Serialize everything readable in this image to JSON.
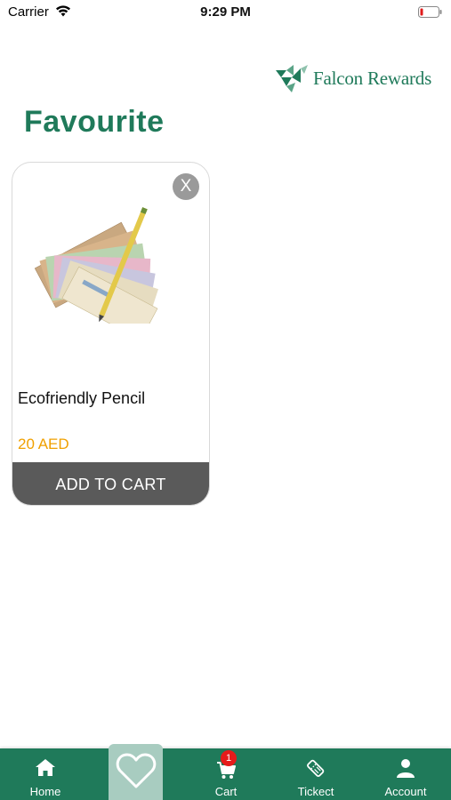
{
  "status_bar": {
    "carrier": "Carrier",
    "time": "9:29 PM",
    "battery_level": "low"
  },
  "header": {
    "brand_name": "Falcon Rewards",
    "brand_color": "#1f7a5a"
  },
  "page": {
    "title": "Favourite"
  },
  "favourites": [
    {
      "name": "Ecofriendly Pencil",
      "price": "20 AED",
      "remove_label": "X",
      "button_label": "ADD TO CART",
      "image": "banknotes-with-pencil"
    }
  ],
  "tab_bar": {
    "active": "favourite",
    "items": [
      {
        "label": "Home",
        "icon": "home-icon"
      },
      {
        "label": "",
        "icon": "heart-icon"
      },
      {
        "label": "Cart",
        "icon": "cart-icon",
        "badge": "1"
      },
      {
        "label": "Tickect",
        "icon": "ticket-icon"
      },
      {
        "label": "Account",
        "icon": "account-icon"
      }
    ]
  },
  "colors": {
    "accent": "#1f7a5a",
    "price": "#f0a000",
    "badge": "#e51b1b",
    "button": "#5a5a5a",
    "active_tab": "#a8ccc0"
  }
}
